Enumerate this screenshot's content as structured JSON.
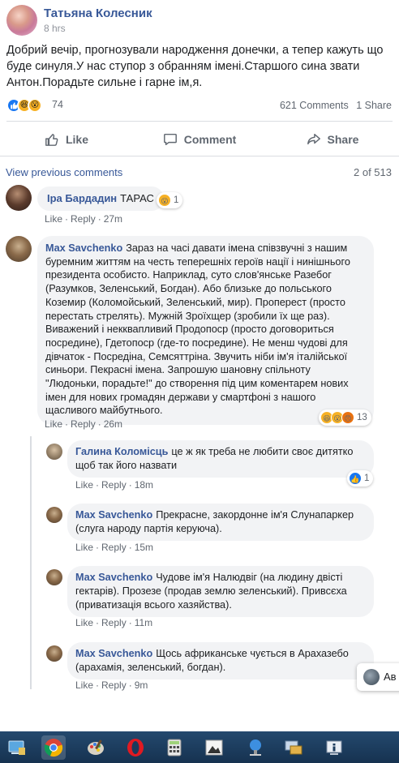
{
  "post": {
    "author": "Татьяна Колесник",
    "time": "8 hrs",
    "text": "Добрий вечір, прогнозували народження донечки, а тепер кажуть що буде синуля.У нас ступор з обранням імені.Старшого сина звати Антон.Порадьте сильне і гарне ім,я.",
    "reaction_count": "74",
    "comments_count": "621 Comments",
    "shares_count": "1 Share"
  },
  "actions": {
    "like": "Like",
    "comment": "Comment",
    "share": "Share"
  },
  "comments_nav": {
    "view_previous": "View previous comments",
    "pager": "2 of 513"
  },
  "comments": [
    {
      "name": "Іра Бардадин",
      "text": "ТАРАС",
      "like": "Like",
      "reply": "Reply",
      "time": "27m",
      "reactions": "1"
    },
    {
      "name": "Max Savchenko",
      "text": "Зараз на часі давати імена співзвучні з нашим буремним життям на честь теперешніх героїв нації і нинішнього президента особисто. Наприклад, суто слов'янське Разебог (Разумков, Зеленський, Богдан). Або близьке до польського Коземир (Коломойський, Зеленський, мир). Проперест (просто перестать стрелять). Мужній Зроїхщер (зробили їх ще раз). Виважений і некквапливий Продопоср (просто договориться посредине), Гдетопоср (где-то посредине). Не менш чудові для дівчаток - Посредіна, Семсяттріна. Звучить ніби ім'я італійської синьори. Пекрасні імена. Запрошую шановну спільноту \"Людоньки, порадьте!\" до створення під цим коментарем нових імен для нових громадян держави у смартфоні з нашого щасливого майбутнього.",
      "like": "Like",
      "reply": "Reply",
      "time": "26m",
      "reactions": "13"
    }
  ],
  "replies": [
    {
      "name": "Галина Коломісць",
      "text": "це ж як треба не любити своє дитятко щоб так його назвати",
      "like": "Like",
      "reply": "Reply",
      "time": "18m",
      "reactions": "1"
    },
    {
      "name": "Max Savchenko",
      "text": "Прекрасне, закордонне ім'я Слунапаркер (слуга народу партія керуюча).",
      "like": "Like",
      "reply": "Reply",
      "time": "15m"
    },
    {
      "name": "Max Savchenko",
      "text": "Чудове ім'я Налюдвіг (на людину двісті гектарів). Прозезе (продав землю зеленський). Привсєха (приватизація всього хазяйства).",
      "like": "Like",
      "reply": "Reply",
      "time": "11m"
    },
    {
      "name": "Max Savchenko",
      "text": "Щось африканське чується в Арахазебо (арахамія, зеленський, богдан).",
      "like": "Like",
      "reply": "Reply",
      "time": "9m"
    }
  ],
  "chat_popup": {
    "label": "Ав"
  },
  "colors": {
    "link": "#385898",
    "bubble": "#f2f3f5",
    "taskbar": "#1b3a5c"
  }
}
